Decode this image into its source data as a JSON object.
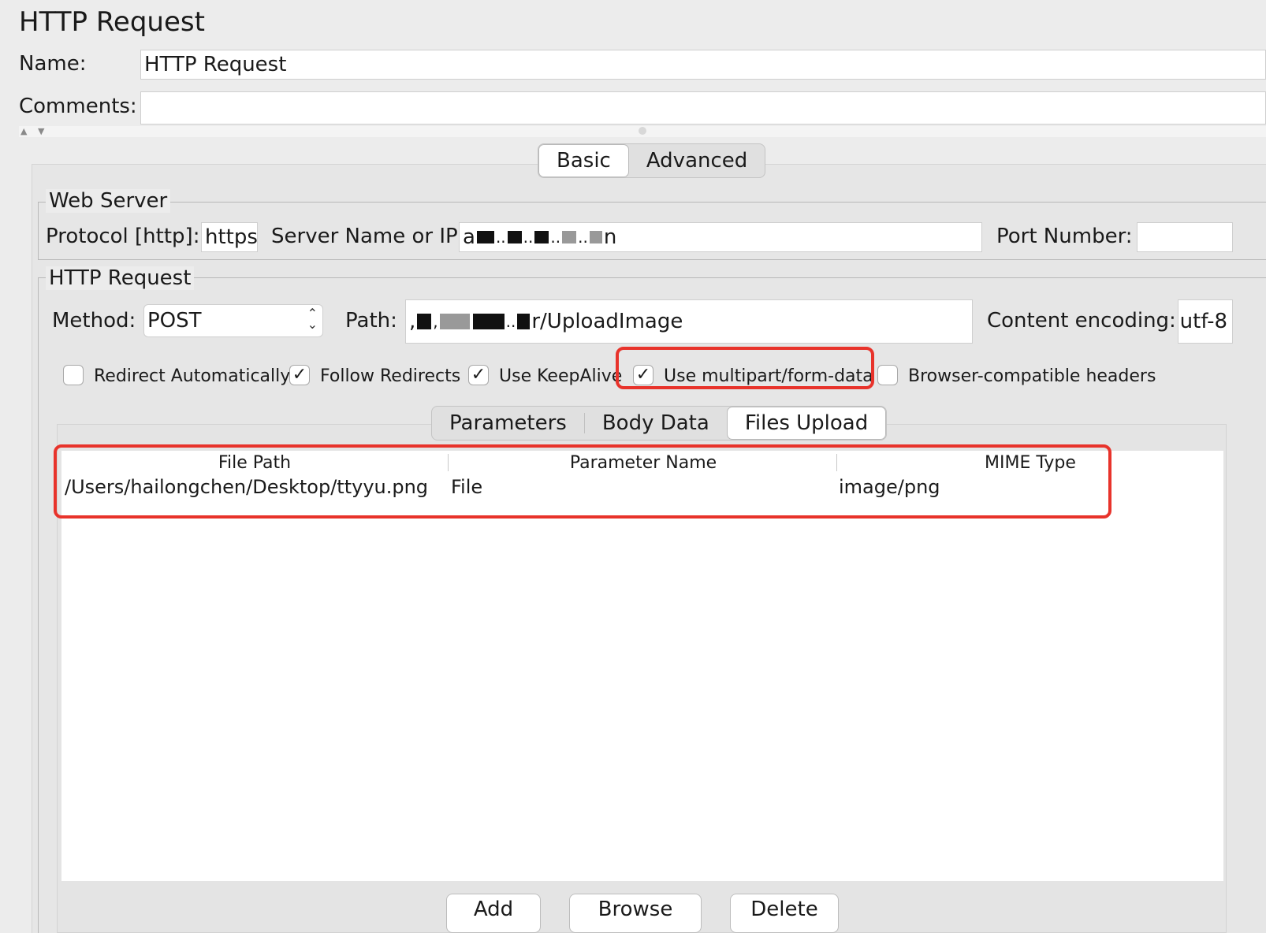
{
  "window": {
    "title": "HTTP Request"
  },
  "form": {
    "name_label": "Name:",
    "name_value": "HTTP Request",
    "comments_label": "Comments:",
    "comments_value": ""
  },
  "splitter": {
    "up_arrow": "▲",
    "down_arrow": "▼"
  },
  "main_tabs": [
    {
      "label": "Basic",
      "selected": true
    },
    {
      "label": "Advanced",
      "selected": false
    }
  ],
  "web_server": {
    "legend": "Web Server",
    "protocol_label": "Protocol [http]:",
    "protocol_value": "https",
    "server_label": "Server Name or IP:",
    "server_value_visible_suffix": "n",
    "port_label": "Port Number:",
    "port_value": ""
  },
  "http_request": {
    "legend": "HTTP Request",
    "method_label": "Method:",
    "method_value": "POST",
    "path_label": "Path:",
    "path_value_visible_suffix": "r/UploadImage",
    "encoding_label": "Content encoding:",
    "encoding_value": "utf-8"
  },
  "options": [
    {
      "label": "Redirect Automatically",
      "checked": false
    },
    {
      "label": "Follow Redirects",
      "checked": true
    },
    {
      "label": "Use KeepAlive",
      "checked": true
    },
    {
      "label": "Use multipart/form-data",
      "checked": true,
      "highlighted": true
    },
    {
      "label": "Browser-compatible headers",
      "checked": false
    }
  ],
  "sub_tabs": [
    {
      "label": "Parameters",
      "selected": false
    },
    {
      "label": "Body Data",
      "selected": false
    },
    {
      "label": "Files Upload",
      "selected": true
    }
  ],
  "files_table": {
    "columns": [
      "File Path",
      "Parameter Name",
      "MIME Type"
    ],
    "rows": [
      [
        "/Users/hailongchen/Desktop/ttyyu.png",
        "File",
        "image/png"
      ]
    ]
  },
  "buttons": {
    "add": "Add",
    "browse": "Browse",
    "delete": "Delete"
  },
  "colors": {
    "highlight": "#e8332b",
    "background": "#ececec"
  },
  "icons": {
    "checkmark": "✓",
    "spinner": "updown-chevron-icon"
  }
}
